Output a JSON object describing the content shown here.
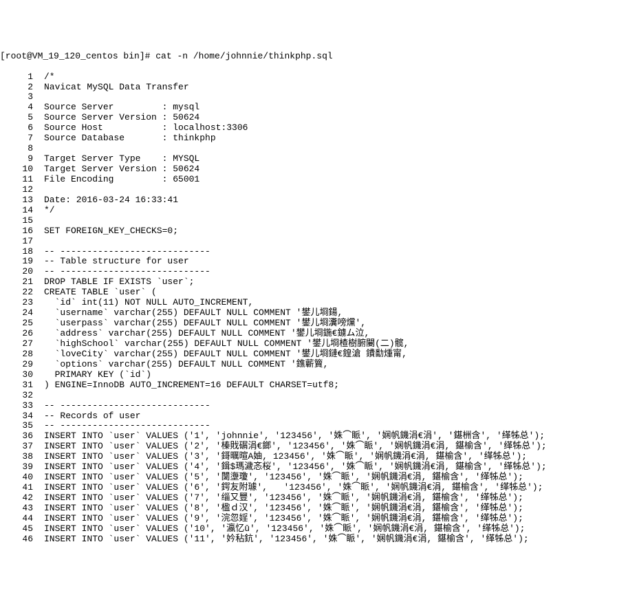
{
  "prompt": "[root@VM_19_120_centos bin]# cat -n /home/johnnie/thinkphp.sql",
  "lines": [
    {
      "n": "1",
      "t": "/*"
    },
    {
      "n": "2",
      "t": "Navicat MySQL Data Transfer"
    },
    {
      "n": "3",
      "t": ""
    },
    {
      "n": "4",
      "t": "Source Server         : mysql"
    },
    {
      "n": "5",
      "t": "Source Server Version : 50624"
    },
    {
      "n": "6",
      "t": "Source Host           : localhost:3306"
    },
    {
      "n": "7",
      "t": "Source Database       : thinkphp"
    },
    {
      "n": "8",
      "t": ""
    },
    {
      "n": "9",
      "t": "Target Server Type    : MYSQL"
    },
    {
      "n": "10",
      "t": "Target Server Version : 50624"
    },
    {
      "n": "11",
      "t": "File Encoding         : 65001"
    },
    {
      "n": "12",
      "t": ""
    },
    {
      "n": "13",
      "t": "Date: 2016-03-24 16:33:41"
    },
    {
      "n": "14",
      "t": "*/"
    },
    {
      "n": "15",
      "t": ""
    },
    {
      "n": "16",
      "t": "SET FOREIGN_KEY_CHECKS=0;"
    },
    {
      "n": "17",
      "t": ""
    },
    {
      "n": "18",
      "t": "-- ----------------------------"
    },
    {
      "n": "19",
      "t": "-- Table structure for user"
    },
    {
      "n": "20",
      "t": "-- ----------------------------"
    },
    {
      "n": "21",
      "t": "DROP TABLE IF EXISTS `user`;"
    },
    {
      "n": "22",
      "t": "CREATE TABLE `user` ("
    },
    {
      "n": "23",
      "t": "  `id` int(11) NOT NULL AUTO_INCREMENT,"
    },
    {
      "n": "24",
      "t": "  `username` varchar(255) DEFAULT NULL COMMENT '鐢儿埛鍚,"
    },
    {
      "n": "25",
      "t": "  `userpass` varchar(255) DEFAULT NULL COMMENT '鐢儿埛瀵嗙爣',"
    },
    {
      "n": "26",
      "t": "  `address` varchar(255) DEFAULT NULL COMMENT '鐢儿埛鍦€鐪ム泣,"
    },
    {
      "n": "27",
      "t": "  `highSchool` varchar(255) DEFAULT NULL COMMENT '鐢儿埛楂樹腑闄(二)髋,"
    },
    {
      "n": "28",
      "t": "  `loveCity` varchar(255) DEFAULT NULL COMMENT '鐢儿埛鏈€鍠滄 鐨勫煄甯,"
    },
    {
      "n": "29",
      "t": "  `options` varchar(255) DEFAULT NULL COMMENT '鐎蘄簤,"
    },
    {
      "n": "30",
      "t": "  PRIMARY KEY (`id`)"
    },
    {
      "n": "31",
      "t": ") ENGINE=InnoDB AUTO_INCREMENT=16 DEFAULT CHARSET=utf8;"
    },
    {
      "n": "32",
      "t": ""
    },
    {
      "n": "33",
      "t": "-- ----------------------------"
    },
    {
      "n": "34",
      "t": "-- Records of user"
    },
    {
      "n": "35",
      "t": "-- ----------------------------"
    },
    {
      "n": "36",
      "t": "INSERT INTO `user` VALUES ('1', 'johnnie', '123456', '姝⌒眽', '娴帆鐖涓€涓', '鍖栦含', '缂牬总');"
    },
    {
      "n": "37",
      "t": "INSERT INTO `user` VALUES ('2', '榛戝碿涓€鎯', '123456', '姝⌒眽', '娴帆鐖涓€涓, 鍖榆含', '缂牬总');"
    },
    {
      "n": "38",
      "t": "INSERT INTO `user` VALUES ('3', '鎶曞暄A妯, 123456', '姝⌒眽', '娴帆鐖涓€涓, 鍖榆含', '缂牬总');"
    },
    {
      "n": "39",
      "t": "INSERT INTO `user` VALUES ('4', '鍓$瑪濊忞桜', '123456', '姝⌒眽', '娴帆鐖涓€涓, 鍖榆含', '缂牬总');"
    },
    {
      "n": "40",
      "t": "INSERT INTO `user` VALUES ('5', '闅塰瓊', '123456', '姝⌒眽', '娴帆鐖涓€涓, 鍖榆含', '缂牬总');"
    },
    {
      "n": "41",
      "t": "INSERT INTO `user` VALUES ('6', '鍔友附璩',   '123456', '姝⌒眽', '娴帆鐖涓€涓, 鍖榆含', '缂牬总');"
    },
    {
      "n": "42",
      "t": "INSERT INTO `user` VALUES ('7', '缁又豐', '123456', '姝⌒眽', '娴帆鐖涓€涓, 鍖榆含', '缂牬总');"
    },
    {
      "n": "43",
      "t": "INSERT INTO `user` VALUES ('8', '楹ｄ汉', '123456', '姝⌒眽', '娴帆鐖涓€涓, 鍖榆含', '缂牬总');"
    },
    {
      "n": "44",
      "t": "INSERT INTO `user` VALUES ('9', '浣忽婬', '123456', '姝⌒眽', '娴帆鐖涓€涓, 鍖榆含', '缂牬总');"
    },
    {
      "n": "45",
      "t": "INSERT INTO `user` VALUES ('10', '瀛忆ū', '123456', '姝⌒眽', '娴帆鐖涓€涓, 鍖榆含', '缂牬总');"
    },
    {
      "n": "46",
      "t": "INSERT INTO `user` VALUES ('11', '妗秥鈧', '123456', '姝⌒眽', '娴帆鐖涓€涓, 鍖榆含', '缂牬总');"
    }
  ]
}
